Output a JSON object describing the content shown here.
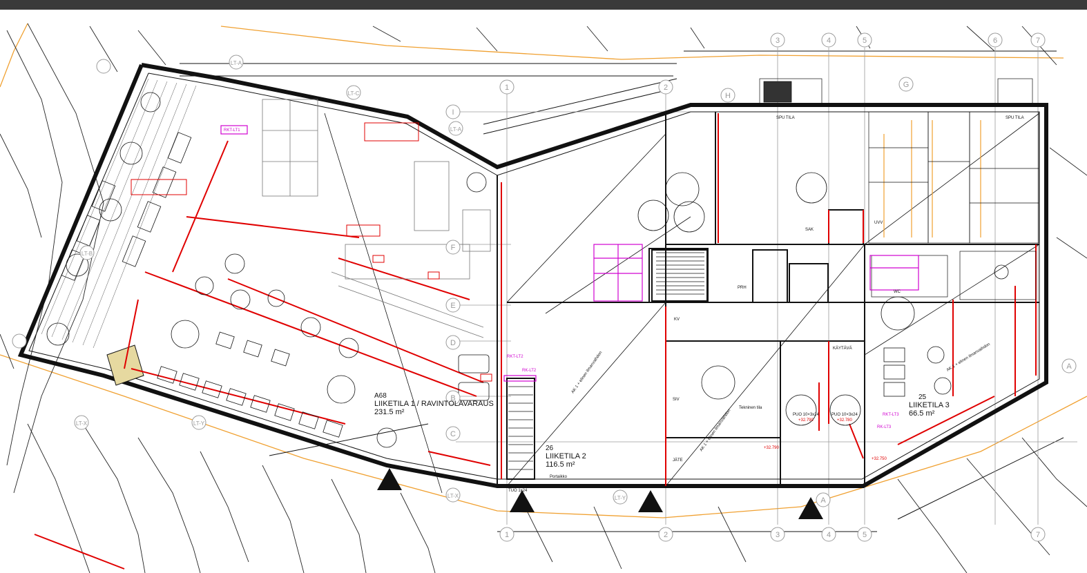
{
  "window": {
    "toolbar_color": "#3a3a3a"
  },
  "colors": {
    "wall": "#111111",
    "red_lines": "#e00000",
    "magenta": "#d000d0",
    "orange_boundary": "#f0a030",
    "grid_lines": "#9a9a9a",
    "highlight_fill": "#e6d9a0"
  },
  "grid_axes": {
    "numbered": [
      "1",
      "2",
      "3",
      "4",
      "5",
      "6",
      "7"
    ],
    "lettered": [
      "A",
      "B",
      "C",
      "D",
      "E",
      "F",
      "G",
      "H",
      "I"
    ],
    "lt_labels": [
      "LT-A",
      "LT-B",
      "LT-C",
      "LT-X",
      "LT-Y"
    ]
  },
  "spaces": {
    "space1": {
      "number": "A68",
      "name": "LIIKETILA 1 / RAVINTOLAVARAUS",
      "area": "231.5 m²"
    },
    "space2": {
      "number": "26",
      "name": "LIIKETILA 2",
      "area": "116.5 m²"
    },
    "space3": {
      "number": "25",
      "name": "LIIKETILA 3",
      "area": "66.5 m²"
    }
  },
  "rooms": {
    "spu1": "SPU TILA",
    "spu2": "SPU TILA",
    "prh": "PRH",
    "sak": "SAK",
    "wc": "WC",
    "uvv": "UVV",
    "kaytava": "KÄYTÄVÄ",
    "jate": "JÄTE",
    "siv": "SIV",
    "kv": "KV"
  },
  "annotations": {
    "rkt_lt1": "RKT-LT1",
    "rkt_lt2": "RKT-LT2",
    "rkt_lt3": "RKT-LT3",
    "rk_lt2": "RK-LT2",
    "rk_lt3": "RK-LT3",
    "puo1": "PUO 10×3x24",
    "puo2": "PUO 10×3x24",
    "tuo1": "TUO 1x24",
    "ak_label": "AK 1 + elinen ilmanvaihdon",
    "level1": "+32.790",
    "level2": "+32.780",
    "level3": "+32.750",
    "note1": "Portaikko",
    "note2": "Tekninen tila"
  }
}
